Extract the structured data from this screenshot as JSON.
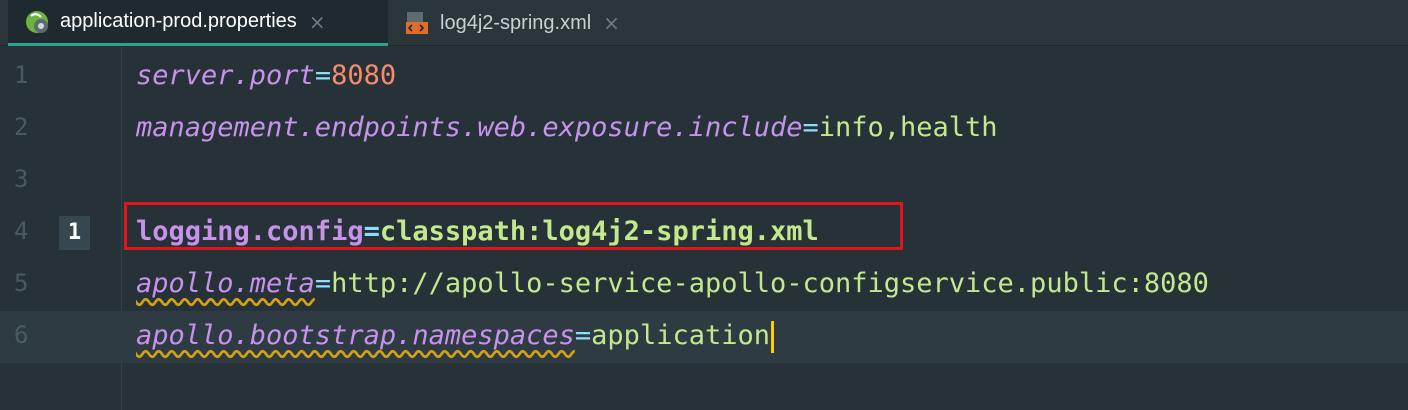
{
  "tabs": [
    {
      "label": "application-prod.properties",
      "icon": "spring-properties-icon",
      "close": "×",
      "active": true
    },
    {
      "label": "log4j2-spring.xml",
      "icon": "xml-file-icon",
      "close": "×",
      "active": false
    }
  ],
  "gutter_marker": "1",
  "lines": [
    {
      "num": "1",
      "key": "server.port",
      "eq": "=",
      "value": "8080"
    },
    {
      "num": "2",
      "key": "management.endpoints.web.exposure.include",
      "eq": "=",
      "value": "info,health"
    },
    {
      "num": "3"
    },
    {
      "num": "4",
      "key": "logging.config",
      "eq": "=",
      "value": "classpath:log4j2-spring.xml"
    },
    {
      "num": "5",
      "key": "apollo.meta",
      "eq": "=",
      "value": "http://apollo-service-apollo-configservice.public:8080"
    },
    {
      "num": "6",
      "key": "apollo.bootstrap.namespaces",
      "eq": "=",
      "value": "application"
    }
  ],
  "colors": {
    "accent": "#2fa08f",
    "highlight_box": "#e0161c",
    "caret": "#ffcc00"
  }
}
